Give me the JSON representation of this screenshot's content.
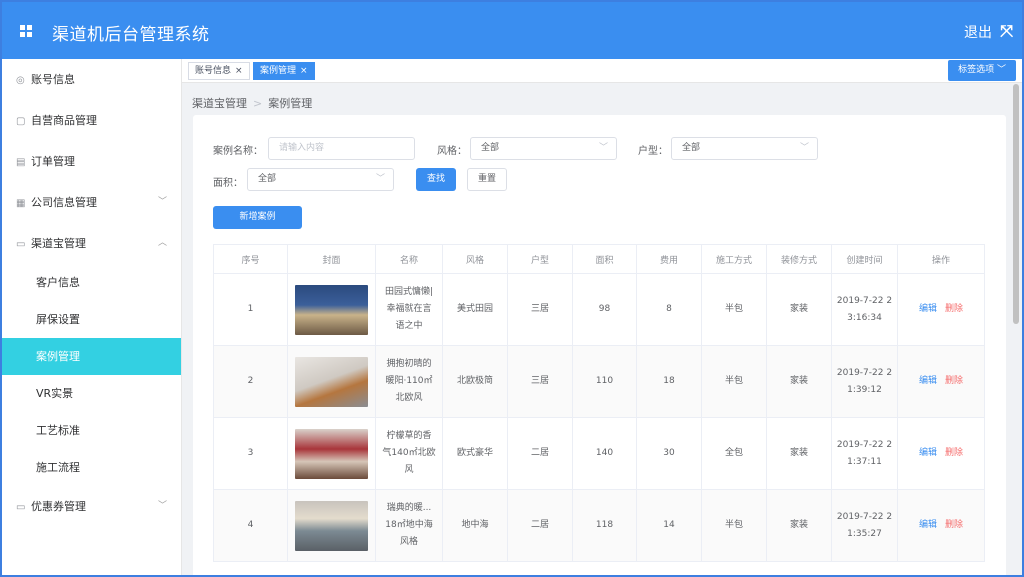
{
  "app": {
    "title": "渠道机后台管理系统",
    "logout": "退出"
  },
  "sidebar": {
    "items": [
      {
        "label": "账号信息",
        "icon": "user-icon"
      },
      {
        "label": "自营商品管理",
        "icon": "goods-icon"
      },
      {
        "label": "订单管理",
        "icon": "order-icon"
      },
      {
        "label": "公司信息管理",
        "icon": "company-icon"
      },
      {
        "label": "渠道宝管理",
        "icon": "channel-icon"
      },
      {
        "label": "优惠券管理",
        "icon": "coupon-icon"
      }
    ],
    "sub_items": [
      "客户信息",
      "屏保设置",
      "案例管理",
      "VR实景",
      "工艺标准",
      "施工流程"
    ]
  },
  "tabs": [
    {
      "label": "账号信息"
    },
    {
      "label": "案例管理"
    }
  ],
  "tab_options": "标签选项",
  "breadcrumb": [
    "渠道宝管理",
    "案例管理"
  ],
  "filters": {
    "name_label": "案例名称：",
    "name_placeholder": "请输入内容",
    "style_label": "风格：",
    "style_value": "全部",
    "layout_label": "户型：",
    "layout_value": "全部",
    "area_label": "面积：",
    "area_value": "全部",
    "search": "查找",
    "reset": "重置"
  },
  "add_button": "新增案例",
  "table": {
    "headers": [
      "序号",
      "封面",
      "名称",
      "风格",
      "户型",
      "面积",
      "费用",
      "施工方式",
      "装修方式",
      "创建时间",
      "操作"
    ],
    "edit": "编辑",
    "delete": "删除",
    "rows": [
      {
        "no": "1",
        "name_lines": [
          "田园式慵懒|",
          "幸福就在言",
          "语之中"
        ],
        "style": "美式田园",
        "layout": "三居",
        "area": "98",
        "cost": "8",
        "build": "半包",
        "decor": "家装",
        "time_lines": [
          "2019-7-22 2",
          "3:16:34"
        ]
      },
      {
        "no": "2",
        "name_lines": [
          "拥抱初晴的",
          "暖阳·110㎡",
          "北欧风"
        ],
        "style": "北欧极简",
        "layout": "三居",
        "area": "110",
        "cost": "18",
        "build": "半包",
        "decor": "家装",
        "time_lines": [
          "2019-7-22 2",
          "1:39:12"
        ]
      },
      {
        "no": "3",
        "name_lines": [
          "柠檬草的香",
          "气140㎡北欧",
          "风"
        ],
        "style": "欧式豪华",
        "layout": "二居",
        "area": "140",
        "cost": "30",
        "build": "全包",
        "decor": "家装",
        "time_lines": [
          "2019-7-22 2",
          "1:37:11"
        ]
      },
      {
        "no": "4",
        "name_lines": [
          "瑞典的暖...",
          "18㎡地中海",
          "风格"
        ],
        "style": "地中海",
        "layout": "二居",
        "area": "118",
        "cost": "14",
        "build": "半包",
        "decor": "家装",
        "time_lines": [
          "2019-7-22 2",
          "1:35:27"
        ]
      }
    ]
  },
  "colors": {
    "primary": "#3a8ef0",
    "active_menu": "#33d0e2",
    "danger": "#f56c6c"
  }
}
